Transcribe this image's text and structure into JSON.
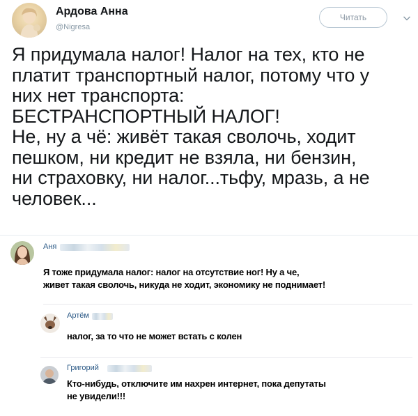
{
  "tweet": {
    "author_name": "Ардова Анна",
    "author_handle": "@Nigresa",
    "follow_label": "Читать",
    "text_lines": [
      "Я придумала налог! Налог на тех, кто не",
      "платит транспортный налог, потому что у",
      "них нет транспорта:",
      "БЕСТРАНСПОРТНЫЙ НАЛОГ!",
      "Не, ну а чё: живёт такая сволочь, ходит",
      "пешком,  ни кредит не взяла, ни бензин,",
      "ни страховку, ни налог...тьфу, мразь, а не",
      "человек..."
    ]
  },
  "comments": [
    {
      "name": "Аня",
      "text_lines": [
        "Я тоже придумала налог: налог на отсутствие ног! Ну а че,",
        "живет такая сволочь, никуда не ходит, экономику не поднимает!"
      ]
    },
    {
      "name": "Артём",
      "text_lines": [
        "налог, за то что не может встать с колен"
      ]
    },
    {
      "name": "Григорий",
      "text_lines": [
        "Кто-нибудь, отключите им нахрен интернет, пока депутаты",
        "не увидели!!!"
      ]
    }
  ],
  "icons": {
    "chevron": "chevron-down-icon"
  },
  "colors": {
    "link_name": "#2a5885",
    "handle": "#8899a6",
    "follow_border": "#b8c7d3"
  }
}
